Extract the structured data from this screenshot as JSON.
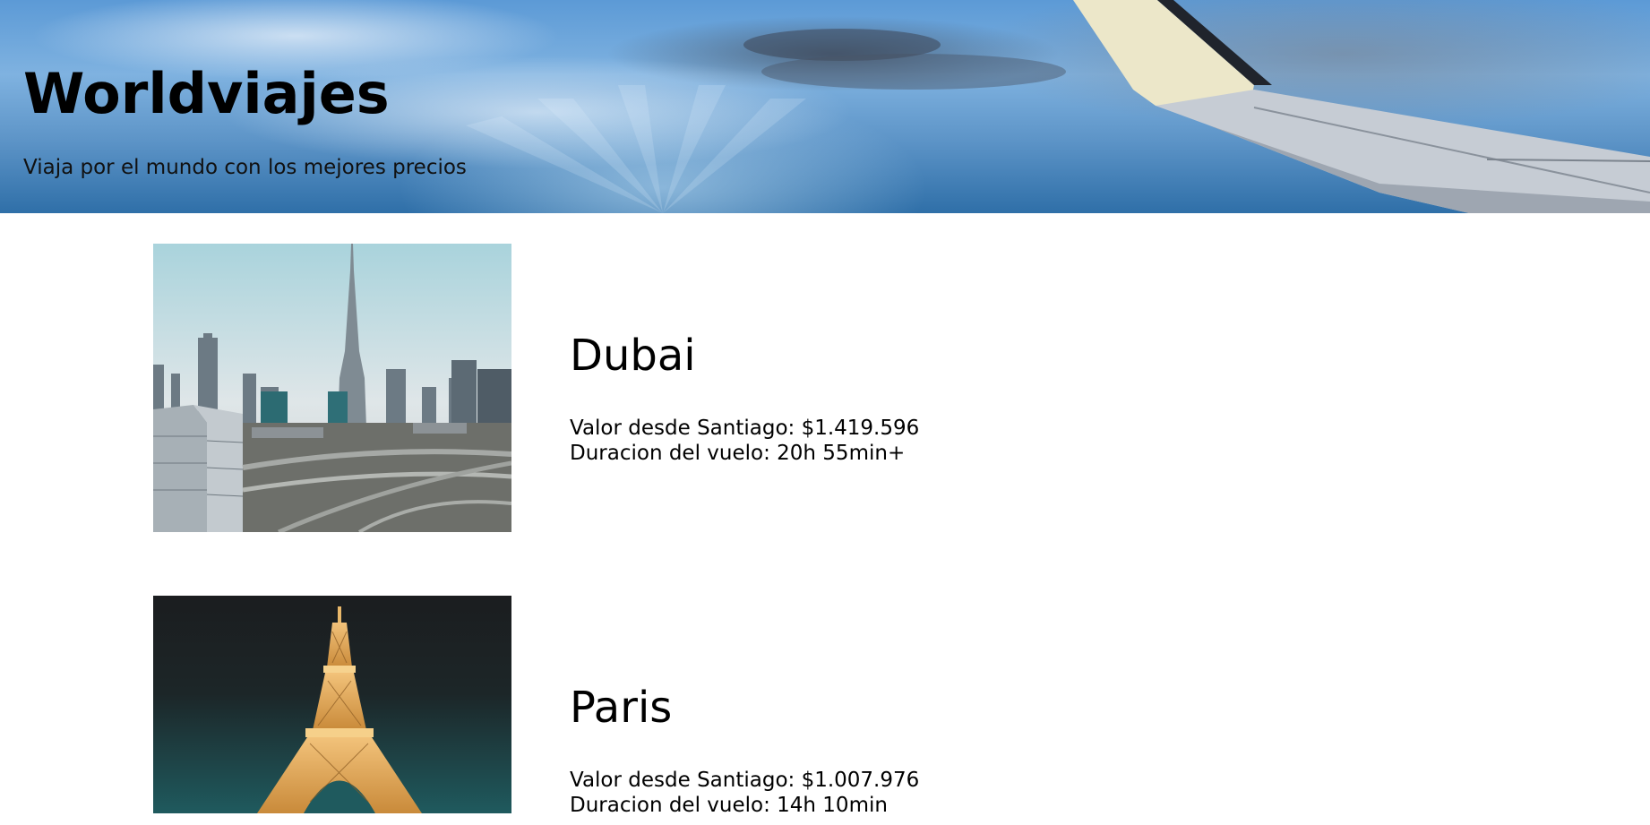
{
  "header": {
    "title": "Worldviajes",
    "subtitle": "Viaja por el mundo con los mejores precios"
  },
  "destinations": [
    {
      "name": "Dubai",
      "price_label": "Valor desde Santiago: $1.419.596",
      "duration_label": "Duracion del vuelo: 20h 55min+",
      "image": "dubai-skyline-photo"
    },
    {
      "name": "Paris",
      "price_label": "Valor desde Santiago: $1.007.976",
      "duration_label": "Duracion del vuelo: 14h 10min",
      "image": "eiffel-tower-night-photo"
    }
  ],
  "colors": {
    "sky": "#5c9ad6",
    "text": "#000000",
    "background": "#ffffff"
  }
}
